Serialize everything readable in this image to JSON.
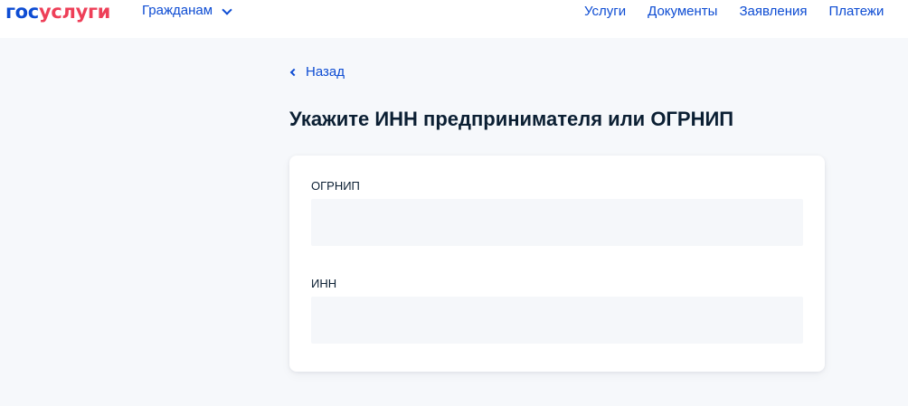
{
  "header": {
    "logo_part_a": "гос",
    "logo_part_b": "услуги",
    "audience_label": "Гражданам",
    "nav": [
      "Услуги",
      "Документы",
      "Заявления",
      "Платежи"
    ]
  },
  "back_label": "Назад",
  "page_title": "Укажите ИНН предпринимателя или ОГРНИП",
  "form": {
    "ogrnip_label": "ОГРНИП",
    "ogrnip_value": "",
    "inn_label": "ИНН",
    "inn_value": ""
  },
  "colors": {
    "accent": "#0d4cd3",
    "brand_red": "#ee3f58",
    "background": "#f6f8fb",
    "text": "#0b1f33"
  },
  "icons": {
    "dropdown": "chevron-down-icon",
    "back": "chevron-left-icon"
  }
}
